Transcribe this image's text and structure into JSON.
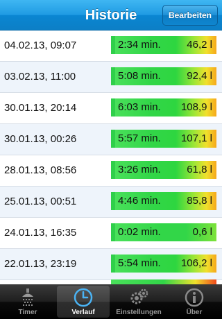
{
  "header": {
    "title": "Historie",
    "edit_label": "Bearbeiten"
  },
  "entries": [
    {
      "date": "04.02.13, 09:07",
      "duration": "2:34 min.",
      "volume": "46,2 l"
    },
    {
      "date": "03.02.13, 11:00",
      "duration": "5:08 min.",
      "volume": "92,4 l"
    },
    {
      "date": "30.01.13, 20:14",
      "duration": "6:03 min.",
      "volume": "108,9 l"
    },
    {
      "date": "30.01.13, 00:26",
      "duration": "5:57 min.",
      "volume": "107,1 l"
    },
    {
      "date": "28.01.13, 08:56",
      "duration": "3:26 min.",
      "volume": "61,8 l"
    },
    {
      "date": "25.01.13, 00:51",
      "duration": "4:46 min.",
      "volume": "85,8 l"
    },
    {
      "date": "24.01.13, 16:35",
      "duration": "0:02 min.",
      "volume": "0,6 l"
    },
    {
      "date": "22.01.13, 23:19",
      "duration": "5:54 min.",
      "volume": "106,2 l"
    }
  ],
  "tabs": [
    {
      "label": "Timer",
      "icon": "shower-icon"
    },
    {
      "label": "Verlauf",
      "icon": "clock-icon",
      "active": true
    },
    {
      "label": "Einstellungen",
      "icon": "gears-icon"
    },
    {
      "label": "Über",
      "icon": "info-icon"
    }
  ],
  "colors": {
    "accent": "#1f9be3",
    "bar_green": "#32d648",
    "bar_yellow": "#f0e02c",
    "bar_orange": "#f6a81c"
  }
}
